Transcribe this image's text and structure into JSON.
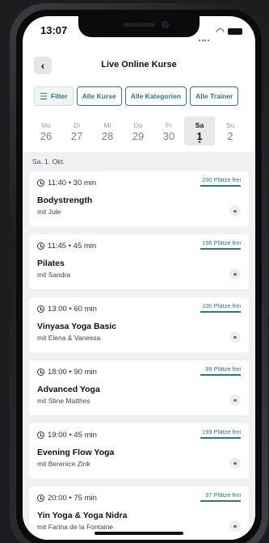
{
  "status": {
    "time": "13:07"
  },
  "nav": {
    "title": "Live Online Kurse",
    "back_glyph": "‹"
  },
  "filters": [
    {
      "label": "Filter"
    },
    {
      "label": "Alle Kurse"
    },
    {
      "label": "Alle Kategorien"
    },
    {
      "label": "Alle Trainer"
    }
  ],
  "days": [
    {
      "dow": "Mo",
      "num": "26"
    },
    {
      "dow": "Di",
      "num": "27"
    },
    {
      "dow": "Mi",
      "num": "28"
    },
    {
      "dow": "Do",
      "num": "29"
    },
    {
      "dow": "Fr",
      "num": "30"
    },
    {
      "dow": "Sa",
      "num": "1",
      "selected": true
    },
    {
      "dow": "So",
      "num": "2"
    }
  ],
  "list": {
    "date_heading": "Sa. 1. Okt.",
    "classes": [
      {
        "time": "11:40 • 30 min",
        "slots": "200 Plätze frei",
        "name": "Bodystrength",
        "teacher": "mit Jule"
      },
      {
        "time": "11:45 • 45 min",
        "slots": "196 Plätze frei",
        "name": "Pilates",
        "teacher": "mit Sandra"
      },
      {
        "time": "13:00 • 60 min",
        "slots": "100 Plätze frei",
        "name": "Vinyasa Yoga Basic",
        "teacher": "mit Elena & Vanessa"
      },
      {
        "time": "18:00 • 90 min",
        "slots": "99 Plätze frei",
        "name": "Advanced Yoga",
        "teacher": "mit Stine Matthes"
      },
      {
        "time": "19:00 • 45 min",
        "slots": "199 Plätze frei",
        "name": "Evening Flow Yoga",
        "teacher": "mit Berenice Zink"
      },
      {
        "time": "20:00 • 75 min",
        "slots": "97 Plätze frei",
        "name": "Yin Yoga & Yoga Nidra",
        "teacher": "mit Farina de la Fontaine"
      }
    ]
  },
  "colors": {
    "accent": "#2b7a86",
    "background": "#eef0f2"
  }
}
